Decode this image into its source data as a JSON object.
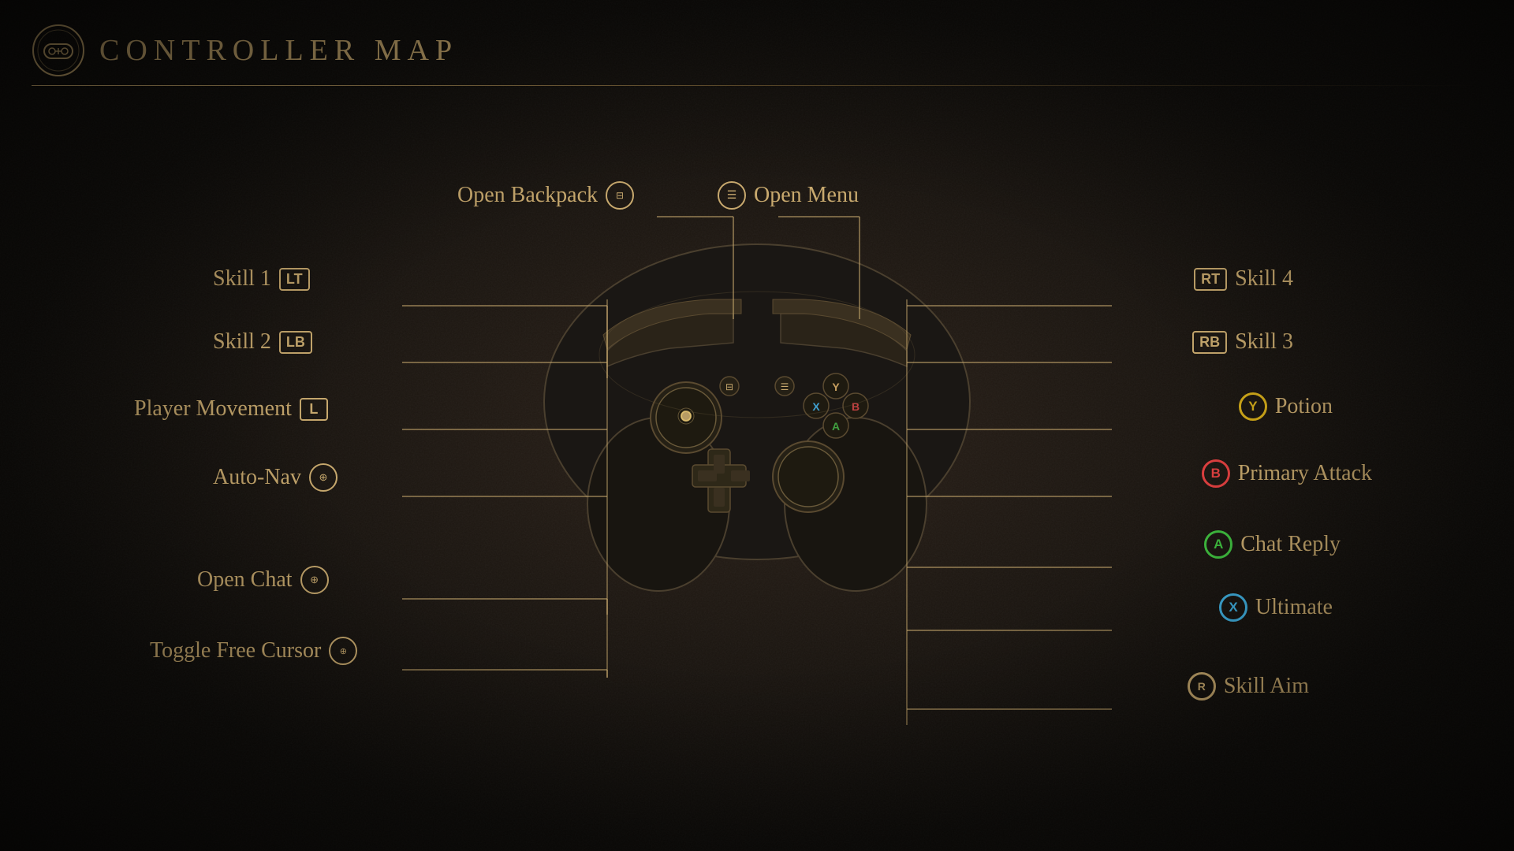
{
  "header": {
    "title": "CONTROLLER MAP",
    "icon_label": "controller-icon"
  },
  "labels": {
    "top_left": {
      "text": "Open Backpack",
      "button": "☰",
      "button_type": "square"
    },
    "top_right": {
      "text": "Open Menu",
      "button": "☰",
      "button_type": "square"
    },
    "left": [
      {
        "text": "Skill 1",
        "button": "LT",
        "button_type": "badge"
      },
      {
        "text": "Skill 2",
        "button": "LB",
        "button_type": "badge"
      },
      {
        "text": "Player Movement",
        "button": "L",
        "button_type": "badge"
      },
      {
        "text": "Auto-Nav",
        "button": "⊕",
        "button_type": "icon"
      },
      {
        "text": "Open Chat",
        "button": "⊕",
        "button_type": "icon"
      },
      {
        "text": "Toggle Free Cursor",
        "button": "⊕",
        "button_type": "icon"
      }
    ],
    "right": [
      {
        "text": "Skill 4",
        "button": "RT",
        "button_type": "badge"
      },
      {
        "text": "Skill 3",
        "button": "RB",
        "button_type": "badge"
      },
      {
        "text": "Potion",
        "button": "Y",
        "button_type": "y"
      },
      {
        "text": "Primary Attack",
        "button": "B",
        "button_type": "b"
      },
      {
        "text": "Chat Reply",
        "button": "A",
        "button_type": "a"
      },
      {
        "text": "Ultimate",
        "button": "X",
        "button_type": "x"
      },
      {
        "text": "Skill Aim",
        "button": "R",
        "button_type": "r"
      }
    ]
  },
  "colors": {
    "gold": "#c8a96e",
    "dark_bg": "#1a1510",
    "y_color": "#d4ac1a",
    "b_color": "#e04040",
    "a_color": "#40c040",
    "x_color": "#40b0e0"
  }
}
